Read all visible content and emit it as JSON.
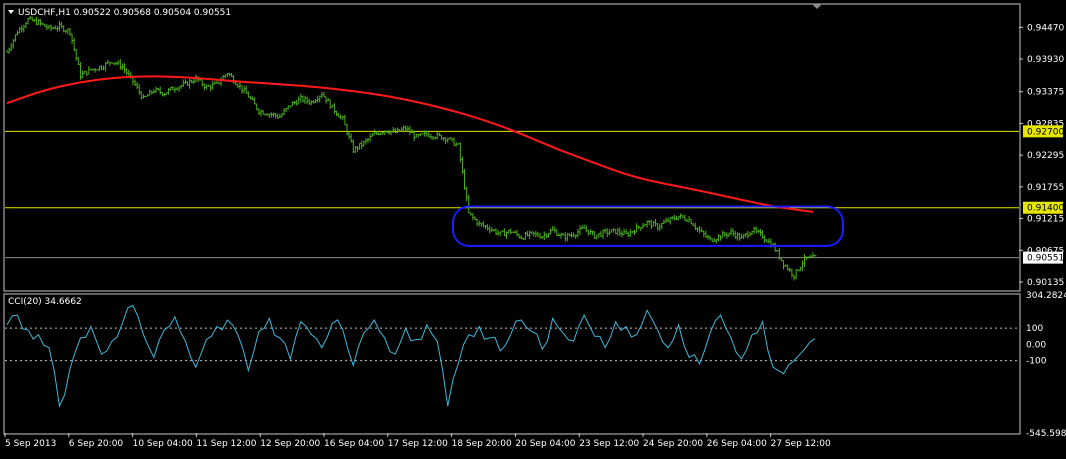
{
  "colors": {
    "background": "#000000",
    "frame": "#c8c8c8",
    "price_bars": "#4caf1e",
    "moving_average": "#ff1a1a",
    "level_lines": "#e6e600",
    "bid_line": "#8c8c8c",
    "annotation_box": "#1a1aff",
    "cci_line": "#3fb8d8",
    "cci_levels": "#bfbfbf",
    "text": "#ffffff"
  },
  "chart_data": [
    {
      "type": "ohlc",
      "title": "USDCHF,H1",
      "ohlc": [
        "0.90522",
        "0.90568",
        "0.90504",
        "0.90551"
      ],
      "ylim": [
        0.9,
        0.9485
      ],
      "y_ticks": [
        "0.94470",
        "0.93930",
        "0.93375",
        "0.92835",
        "0.92295",
        "0.91755",
        "0.91215",
        "0.90675",
        "0.90135"
      ],
      "x_ticks": [
        "5 Sep 2013",
        "6 Sep 20:00",
        "10 Sep 04:00",
        "11 Sep 12:00",
        "12 Sep 20:00",
        "16 Sep 04:00",
        "17 Sep 12:00",
        "18 Sep 20:00",
        "20 Sep 04:00",
        "23 Sep 12:00",
        "24 Sep 20:00",
        "26 Sep 04:00",
        "27 Sep 12:00"
      ],
      "closes": [
        0.9405,
        0.944,
        0.946,
        0.9455,
        0.9445,
        0.9448,
        0.944,
        0.9365,
        0.9375,
        0.938,
        0.939,
        0.938,
        0.9355,
        0.9325,
        0.934,
        0.9335,
        0.9345,
        0.935,
        0.936,
        0.9345,
        0.935,
        0.937,
        0.935,
        0.933,
        0.9305,
        0.93,
        0.9295,
        0.9315,
        0.9325,
        0.932,
        0.9335,
        0.931,
        0.929,
        0.9238,
        0.925,
        0.9265,
        0.9272,
        0.9268,
        0.9275,
        0.926,
        0.9265,
        0.9262,
        0.9258,
        0.9245,
        0.913,
        0.9112,
        0.9105,
        0.9095,
        0.91,
        0.909,
        0.9095,
        0.9092,
        0.9102,
        0.909,
        0.9095,
        0.9105,
        0.9092,
        0.9098,
        0.91,
        0.9094,
        0.9105,
        0.9115,
        0.9108,
        0.9118,
        0.9125,
        0.912,
        0.91,
        0.9085,
        0.9092,
        0.9098,
        0.9088,
        0.9102,
        0.9092,
        0.9075,
        0.9045,
        0.9025,
        0.9052,
        0.9055
      ],
      "moving_average": [
        0.9318,
        0.934,
        0.9354,
        0.9362,
        0.9364,
        0.9362,
        0.9356,
        0.9352,
        0.9348,
        0.9342,
        0.9334,
        0.9323,
        0.9308,
        0.929,
        0.9267,
        0.924,
        0.9217,
        0.9194,
        0.918,
        0.9168,
        0.9154,
        0.9141,
        0.9133
      ],
      "levels": [
        {
          "value": 0.927,
          "label": "0.92700"
        },
        {
          "value": 0.914,
          "label": "0.91400"
        }
      ],
      "current_price": {
        "value": 0.90551,
        "label": "0.90551"
      }
    },
    {
      "type": "line",
      "title": "CCI(20) 34.6662",
      "ylim": [
        -545.5983,
        304.2824
      ],
      "y_ticks": [
        "304.2824",
        "100",
        "0.00",
        "-100",
        "-545.5983"
      ],
      "levels": [
        100,
        -100
      ],
      "values": [
        120,
        180,
        90,
        60,
        -20,
        -380,
        -150,
        40,
        110,
        -60,
        20,
        130,
        240,
        60,
        -80,
        90,
        170,
        20,
        -140,
        30,
        110,
        150,
        60,
        -160,
        80,
        160,
        40,
        -90,
        140,
        60,
        -20,
        130,
        90,
        -130,
        70,
        150,
        40,
        -60,
        100,
        30,
        120,
        20,
        -380,
        -120,
        60,
        110,
        40,
        -40,
        60,
        150,
        80,
        -30,
        160,
        70,
        20,
        180,
        50,
        -20,
        140,
        110,
        60,
        210,
        90,
        -20,
        120,
        -80,
        -120,
        70,
        180,
        40,
        -90,
        60,
        140,
        -140,
        -180,
        -100,
        -30,
        35
      ]
    }
  ]
}
